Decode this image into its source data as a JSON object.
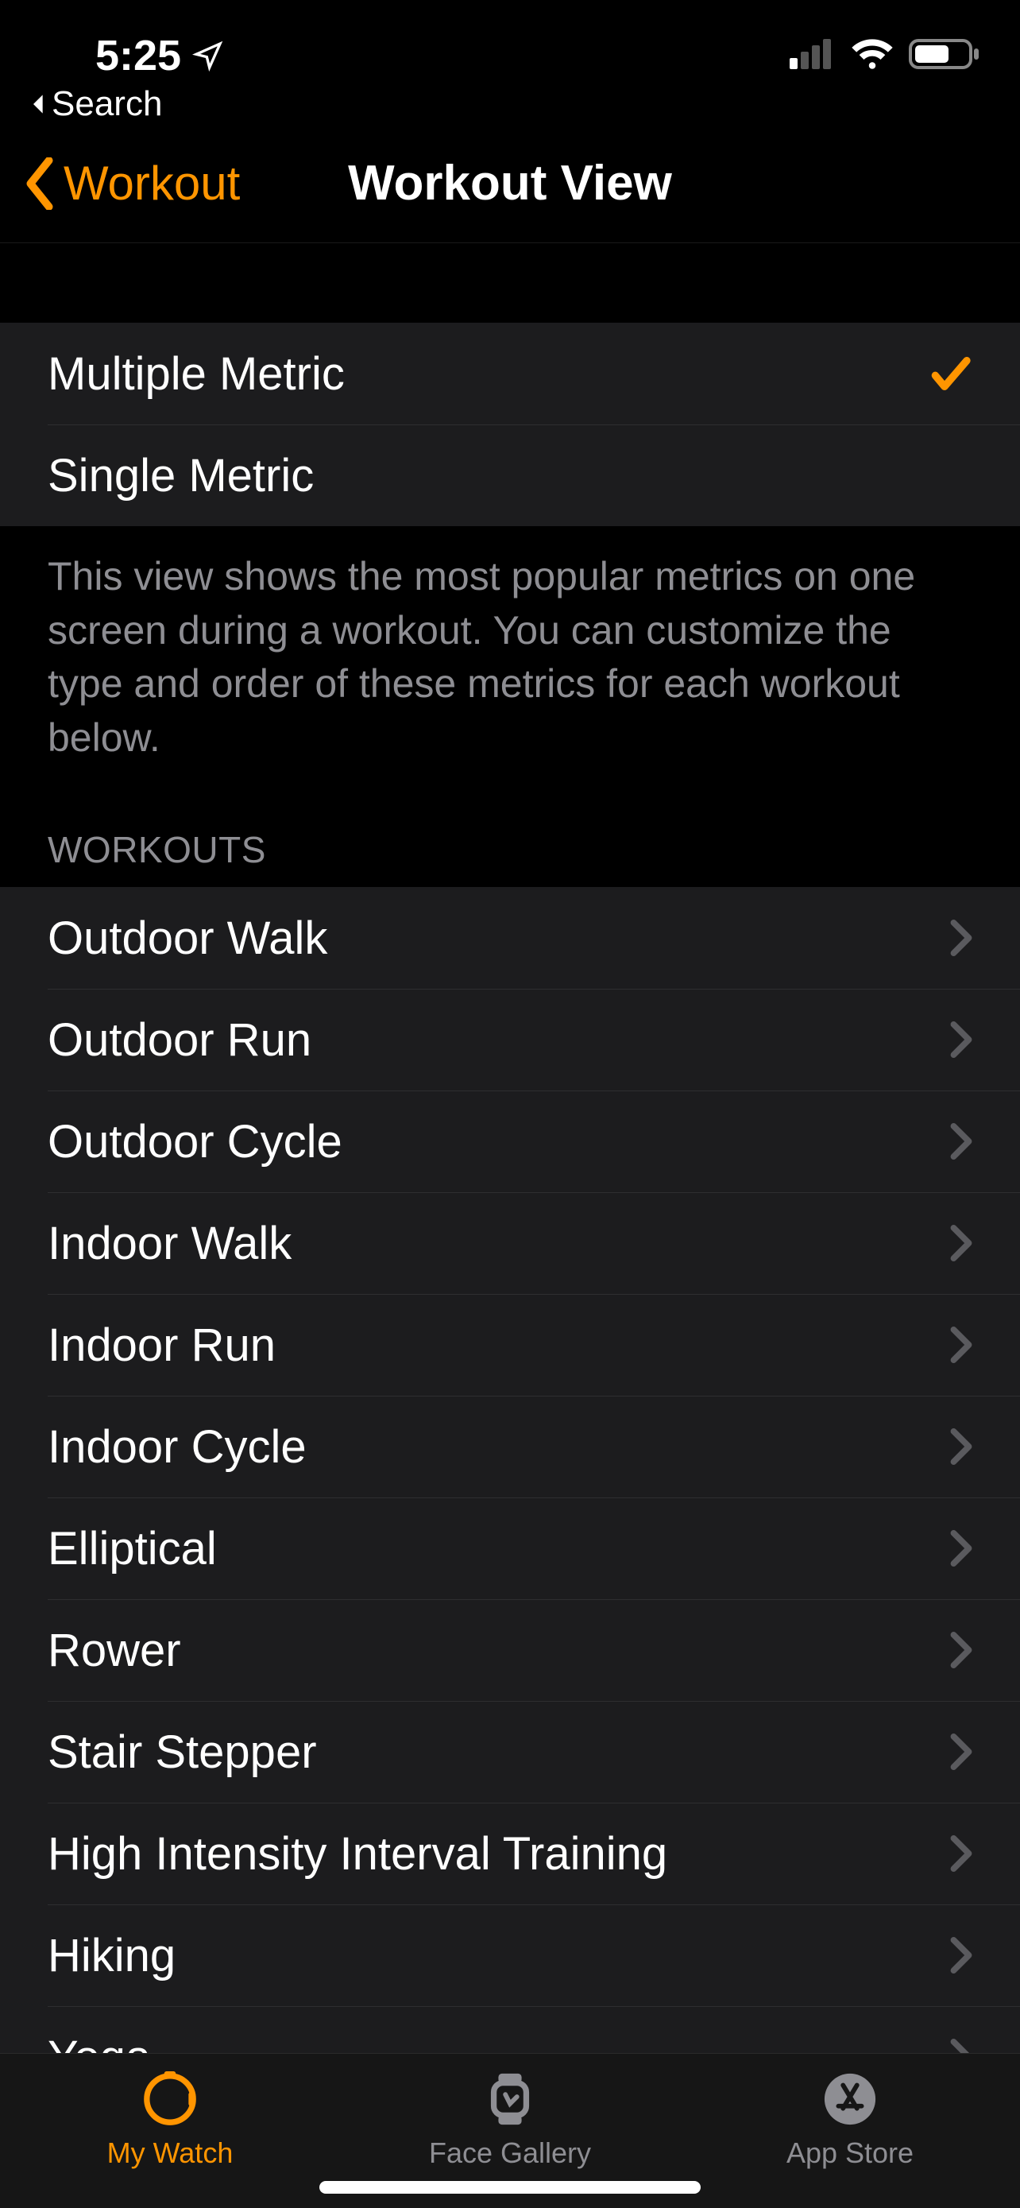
{
  "status": {
    "time": "5:25",
    "back_app": "Search"
  },
  "nav": {
    "back_label": "Workout",
    "title": "Workout View"
  },
  "metric_options": [
    {
      "label": "Multiple Metric",
      "selected": true
    },
    {
      "label": "Single Metric",
      "selected": false
    }
  ],
  "description": "This view shows the most popular metrics on one screen during a workout. You can customize the type and order of these metrics for each workout below.",
  "workouts_header": "WORKOUTS",
  "workouts": [
    {
      "label": "Outdoor Walk"
    },
    {
      "label": "Outdoor Run"
    },
    {
      "label": "Outdoor Cycle"
    },
    {
      "label": "Indoor Walk"
    },
    {
      "label": "Indoor Run"
    },
    {
      "label": "Indoor Cycle"
    },
    {
      "label": "Elliptical"
    },
    {
      "label": "Rower"
    },
    {
      "label": "Stair Stepper"
    },
    {
      "label": "High Intensity Interval Training"
    },
    {
      "label": "Hiking"
    },
    {
      "label": "Yoga"
    }
  ],
  "tabs": {
    "my_watch": "My Watch",
    "face_gallery": "Face Gallery",
    "app_store": "App Store"
  }
}
